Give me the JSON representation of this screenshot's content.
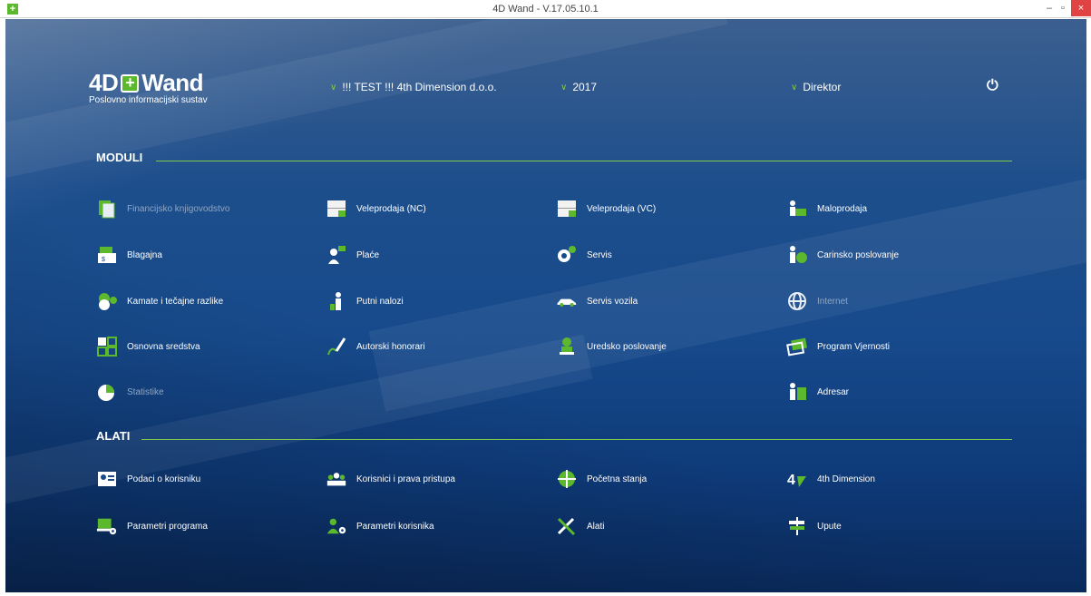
{
  "window": {
    "title": "4D Wand - V.17.05.10.1",
    "close_label": "×",
    "minimize_label": "–",
    "maximize_label": "▫"
  },
  "header": {
    "logo": "4D+Wand",
    "logo_subtitle": "Poslovno informacijski sustav",
    "company": "!!! TEST !!! 4th Dimension d.o.o.",
    "year": "2017",
    "role": "Direktor"
  },
  "sections": {
    "moduli": "MODULI",
    "alati": "ALATI"
  },
  "moduli": [
    {
      "label": "Financijsko knjigovodstvo",
      "icon": "document-copy-icon",
      "disabled": true
    },
    {
      "label": "Veleprodaja (NC)",
      "icon": "warehouse-icon",
      "disabled": false
    },
    {
      "label": "Veleprodaja (VC)",
      "icon": "warehouse-icon",
      "disabled": false
    },
    {
      "label": "Maloprodaja",
      "icon": "shop-icon",
      "disabled": false
    },
    {
      "label": "Blagajna",
      "icon": "cash-register-icon",
      "disabled": false
    },
    {
      "label": "Plaće",
      "icon": "payroll-icon",
      "disabled": false
    },
    {
      "label": "Servis",
      "icon": "service-gear-icon",
      "disabled": false
    },
    {
      "label": "Carinsko poslovanje",
      "icon": "customs-icon",
      "disabled": false
    },
    {
      "label": "Kamate i tečajne razlike",
      "icon": "coins-icon",
      "disabled": false
    },
    {
      "label": "Putni nalozi",
      "icon": "traveler-icon",
      "disabled": false
    },
    {
      "label": "Servis vozila",
      "icon": "car-icon",
      "disabled": false
    },
    {
      "label": "Internet",
      "icon": "globe-icon",
      "disabled": true
    },
    {
      "label": "Osnovna sredstva",
      "icon": "assets-grid-icon",
      "disabled": false
    },
    {
      "label": "Autorski honorari",
      "icon": "pen-icon",
      "disabled": false
    },
    {
      "label": "Uredsko poslovanje",
      "icon": "office-icon",
      "disabled": false
    },
    {
      "label": "Program Vjernosti",
      "icon": "loyalty-card-icon",
      "disabled": false
    },
    {
      "label": "Statistike",
      "icon": "pie-chart-icon",
      "disabled": true
    },
    {
      "label": "Adresar",
      "icon": "contacts-icon",
      "disabled": false
    }
  ],
  "alati": [
    {
      "label": "Podaci o korisniku",
      "icon": "id-card-icon"
    },
    {
      "label": "Korisnici i prava pristupa",
      "icon": "users-icon"
    },
    {
      "label": "Početna stanja",
      "icon": "target-icon"
    },
    {
      "label": "4th Dimension",
      "icon": "4d-logo-icon"
    },
    {
      "label": "Parametri programa",
      "icon": "computer-settings-icon"
    },
    {
      "label": "Parametri korisnika",
      "icon": "user-settings-icon"
    },
    {
      "label": "Alati",
      "icon": "tools-icon"
    },
    {
      "label": "Upute",
      "icon": "signpost-icon"
    }
  ],
  "colors": {
    "accent": "#7ec94a",
    "brand_green": "#5cb82d",
    "background": "#174a8c"
  }
}
